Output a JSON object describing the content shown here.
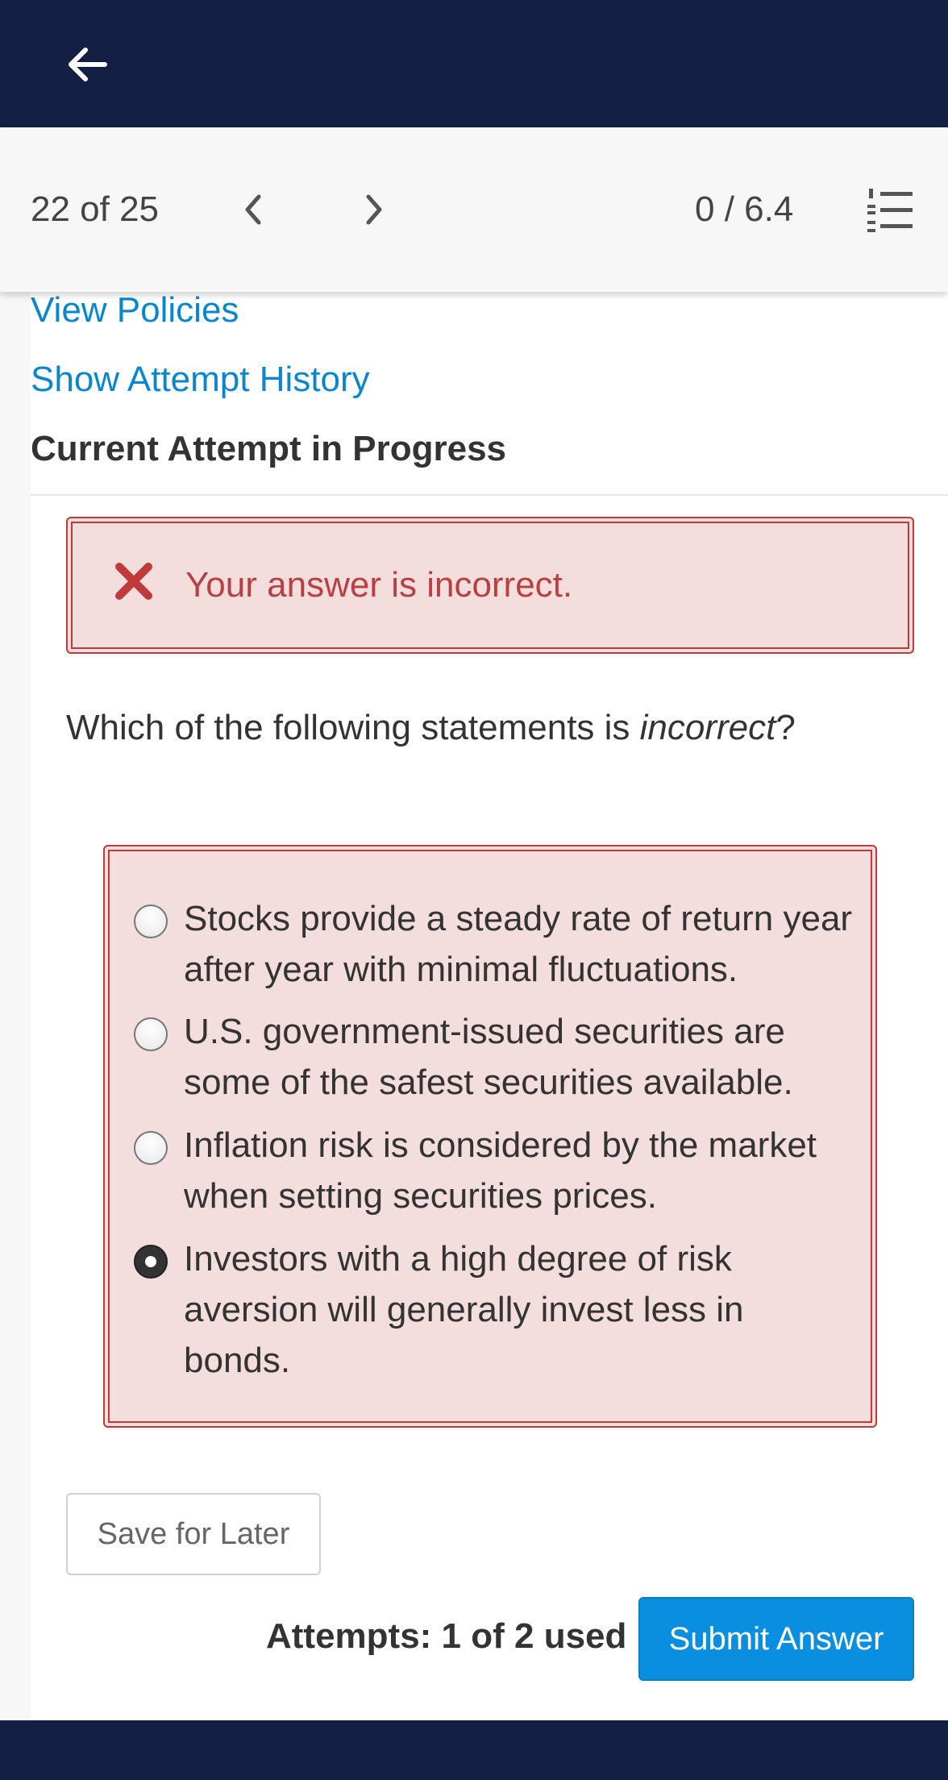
{
  "nav": {
    "counter": "22 of 25",
    "score": "0 / 6.4"
  },
  "links": {
    "view_policies": "View Policies",
    "show_history": "Show Attempt History"
  },
  "heading": "Current Attempt in Progress",
  "feedback": {
    "message": "Your answer is incorrect.",
    "status_color": "#c0393b"
  },
  "question": {
    "prefix": "Which of the following statements is ",
    "emphasis": "incorrect",
    "suffix": "?"
  },
  "options": [
    {
      "text": "Stocks provide a steady rate of return year after year with minimal fluctuations.",
      "selected": false
    },
    {
      "text": "U.S. government-issued securities are some of the safest securities available.",
      "selected": false
    },
    {
      "text": "Inflation risk is considered by the market when setting securities prices.",
      "selected": false
    },
    {
      "text": "Investors with a high degree of risk aversion will generally invest less in bonds.",
      "selected": true
    }
  ],
  "actions": {
    "save_label": "Save for Later",
    "attempts_text": "Attempts: 1 of 2 used",
    "submit_label": "Submit Answer"
  },
  "colors": {
    "header_bg": "#141f44",
    "link": "#0a86cf",
    "primary_button": "#0a8ee0"
  },
  "icons": {
    "back": "arrow-left-icon",
    "prev": "chevron-left-icon",
    "next": "chevron-right-icon",
    "question_list": "numbered-list-icon",
    "error": "close-x-icon"
  }
}
